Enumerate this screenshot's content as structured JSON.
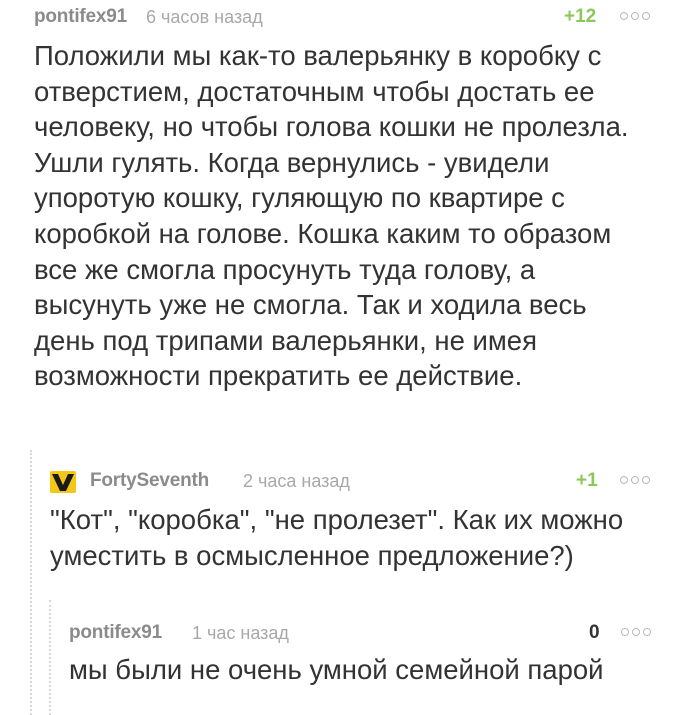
{
  "comments": [
    {
      "username": "pontifex91",
      "time": "6 часов назад",
      "rating": "+12",
      "text": "Положили мы как-то валерьянку в коробку с\nотверстием, достаточным чтобы достать ее\nчеловеку, но чтобы голова кошки не пролезла.\nУшли гулять. Когда вернулись - увидели\nупоротую кошку, гуляющую по квартире с\nкоробкой на голове. Кошка каким то образом\nвсе же смогла просунуть туда голову, а\nвысунуть уже не смогла. Так и ходила весь\nдень под трипами валерьянки, не имея\nвозможности прекратить ее действие."
    },
    {
      "username": "FortySeventh",
      "time": "2 часа назад",
      "rating": "+1",
      "text": "\"Кот\", \"коробка\", \"не пролезет\". Как их можно\nуместить в осмысленное предложение?)"
    },
    {
      "username": "pontifex91",
      "time": "1 час назад",
      "rating": "0",
      "text": "мы были не очень умной семейной парой"
    }
  ],
  "colors": {
    "username": "#8b8b8b",
    "time": "#a8a8a8",
    "positive_rating": "#8ac858",
    "text": "#333333",
    "thread_line": "#d8d8d8"
  },
  "icons": {
    "more": "three-dots-icon",
    "avatar": "wu-tang-logo-avatar"
  }
}
